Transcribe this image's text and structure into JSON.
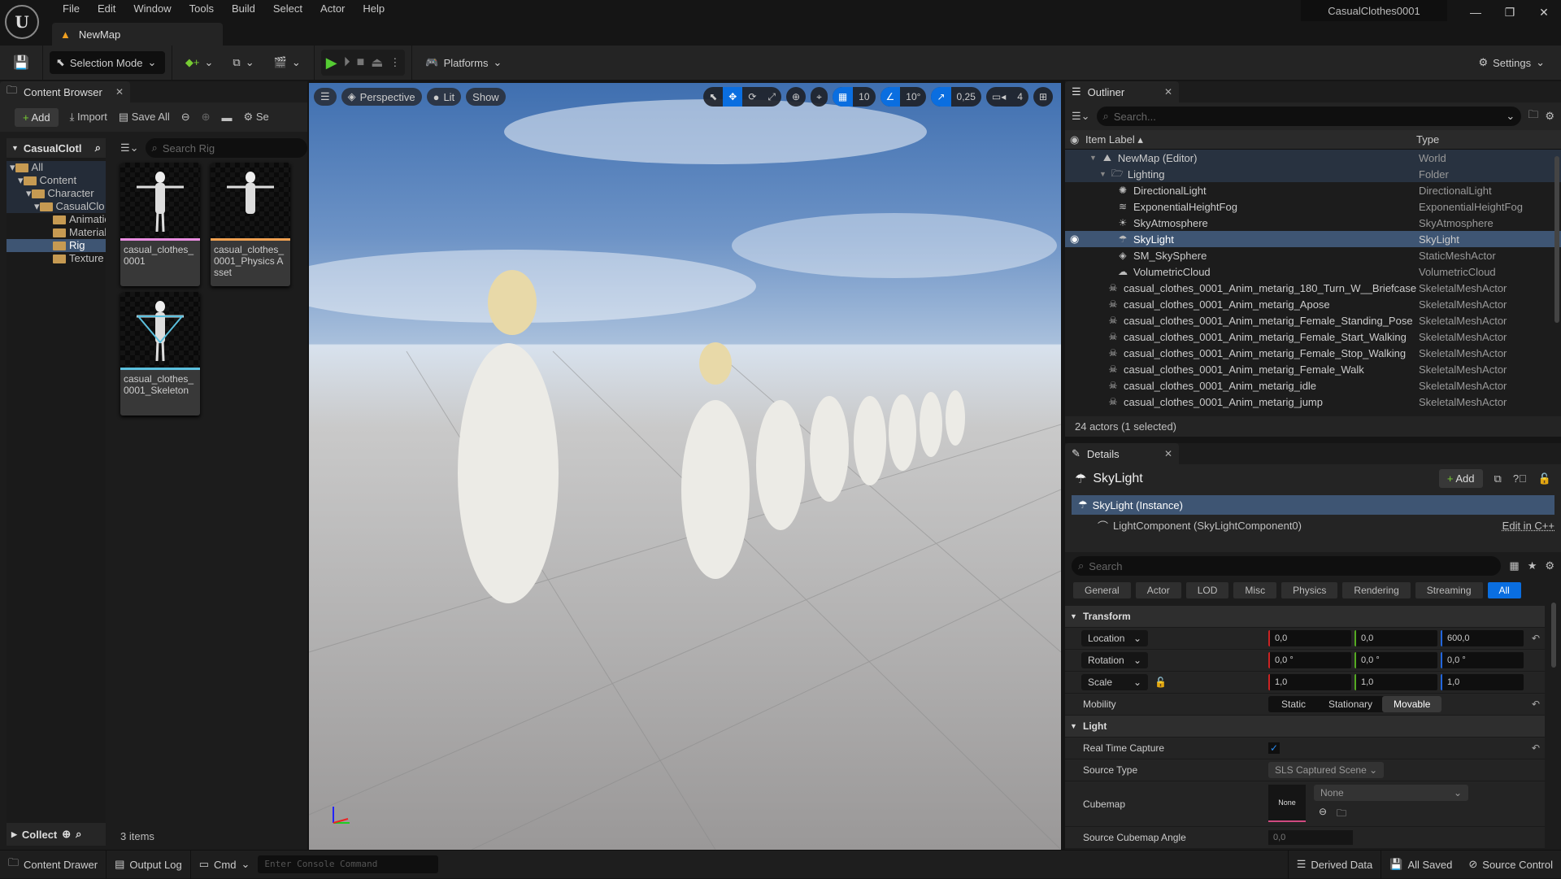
{
  "menu": [
    "File",
    "Edit",
    "Window",
    "Tools",
    "Build",
    "Select",
    "Actor",
    "Help"
  ],
  "map_tab": "NewMap",
  "project_name": "CasualClothes0001",
  "toolbar": {
    "selection_mode": "Selection Mode",
    "platforms": "Platforms",
    "settings": "Settings"
  },
  "content_browser": {
    "tab": "Content Browser",
    "add": "Add",
    "import": "Import",
    "save_all": "Save All",
    "settings_trunc": "Se",
    "source_root": "CasualClotl",
    "search_placeholder": "Search Rig",
    "tree": [
      "All",
      "Content",
      "Character",
      "CasualClo",
      "Animatic",
      "Material",
      "Rig",
      "Texture"
    ],
    "assets": [
      {
        "name": "casual_clothes_0001",
        "color": "#e98de0"
      },
      {
        "name": "casual_clothes_0001_Physics Asset",
        "color": "#f0a050"
      },
      {
        "name": "casual_clothes_0001_Skeleton",
        "color": "#5bc0de"
      }
    ],
    "collect": "Collect",
    "item_count": "3 items"
  },
  "viewport": {
    "perspective": "Perspective",
    "lit": "Lit",
    "show": "Show",
    "grid": "10",
    "angle": "10°",
    "scale": "0,25",
    "camera_speed": "4"
  },
  "outliner": {
    "tab": "Outliner",
    "search_placeholder": "Search...",
    "col_label": "Item Label",
    "col_type": "Type",
    "rows": [
      {
        "label": "NewMap (Editor)",
        "type": "World",
        "icon": "map"
      },
      {
        "label": "Lighting",
        "type": "Folder",
        "icon": "folder"
      },
      {
        "label": "DirectionalLight",
        "type": "DirectionalLight",
        "icon": "sun"
      },
      {
        "label": "ExponentialHeightFog",
        "type": "ExponentialHeightFog",
        "icon": "fog"
      },
      {
        "label": "SkyAtmosphere",
        "type": "SkyAtmosphere",
        "icon": "atmo"
      },
      {
        "label": "SkyLight",
        "type": "SkyLight",
        "icon": "skylight"
      },
      {
        "label": "SM_SkySphere",
        "type": "StaticMeshActor",
        "icon": "mesh"
      },
      {
        "label": "VolumetricCloud",
        "type": "VolumetricCloud",
        "icon": "cloud"
      },
      {
        "label": "casual_clothes_0001_Anim_metarig_180_Turn_W__Briefcase",
        "type": "SkeletalMeshActor",
        "icon": "skel"
      },
      {
        "label": "casual_clothes_0001_Anim_metarig_Apose",
        "type": "SkeletalMeshActor",
        "icon": "skel"
      },
      {
        "label": "casual_clothes_0001_Anim_metarig_Female_Standing_Pose",
        "type": "SkeletalMeshActor",
        "icon": "skel"
      },
      {
        "label": "casual_clothes_0001_Anim_metarig_Female_Start_Walking",
        "type": "SkeletalMeshActor",
        "icon": "skel"
      },
      {
        "label": "casual_clothes_0001_Anim_metarig_Female_Stop_Walking",
        "type": "SkeletalMeshActor",
        "icon": "skel"
      },
      {
        "label": "casual_clothes_0001_Anim_metarig_Female_Walk",
        "type": "SkeletalMeshActor",
        "icon": "skel"
      },
      {
        "label": "casual_clothes_0001_Anim_metarig_idle",
        "type": "SkeletalMeshActor",
        "icon": "skel"
      },
      {
        "label": "casual_clothes_0001_Anim_metarig_jump",
        "type": "SkeletalMeshActor",
        "icon": "skel"
      }
    ],
    "footer": "24 actors (1 selected)"
  },
  "details": {
    "tab": "Details",
    "actor": "SkyLight",
    "add": "Add",
    "instance": "SkyLight (Instance)",
    "component": "LightComponent (SkyLightComponent0)",
    "edit_cpp": "Edit in C++",
    "search_placeholder": "Search",
    "filters": [
      "General",
      "Actor",
      "LOD",
      "Misc",
      "Physics",
      "Rendering",
      "Streaming",
      "All"
    ],
    "transform": "Transform",
    "location": {
      "label": "Location",
      "x": "0,0",
      "y": "0,0",
      "z": "600,0"
    },
    "rotation": {
      "label": "Rotation",
      "x": "0,0 °",
      "y": "0,0 °",
      "z": "0,0 °"
    },
    "scale": {
      "label": "Scale",
      "x": "1,0",
      "y": "1,0",
      "z": "1,0"
    },
    "mobility": {
      "label": "Mobility",
      "options": [
        "Static",
        "Stationary",
        "Movable"
      ]
    },
    "light": "Light",
    "real_time_capture": {
      "label": "Real Time Capture",
      "checked": true
    },
    "source_type": {
      "label": "Source Type",
      "value": "SLS Captured Scene"
    },
    "cubemap": {
      "label": "Cubemap",
      "thumb": "None",
      "value": "None"
    },
    "source_cubemap_angle": {
      "label": "Source Cubemap Angle",
      "value": "0,0"
    }
  },
  "statusbar": {
    "content_drawer": "Content Drawer",
    "output_log": "Output Log",
    "cmd": "Cmd",
    "console_placeholder": "Enter Console Command",
    "derived_data": "Derived Data",
    "all_saved": "All Saved",
    "source_control": "Source Control"
  }
}
